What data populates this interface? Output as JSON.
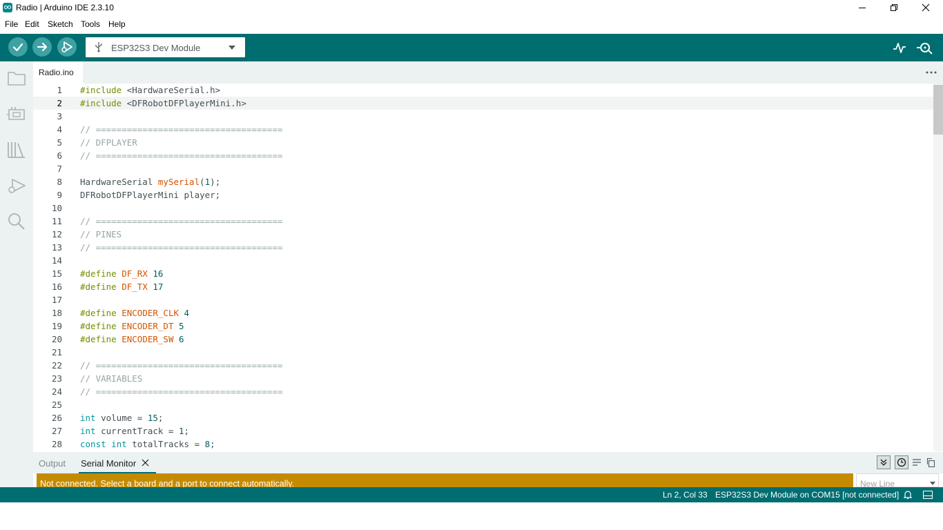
{
  "window": {
    "title": "Radio | Arduino IDE 2.3.10"
  },
  "menu": [
    "File",
    "Edit",
    "Sketch",
    "Tools",
    "Help"
  ],
  "toolbar": {
    "board": "ESP32S3 Dev Module"
  },
  "tabs": [
    {
      "label": "Radio.ino"
    }
  ],
  "editor": {
    "current_line": 2,
    "lines": [
      {
        "n": "1",
        "code": "#include <HardwareSerial.h>"
      },
      {
        "n": "2",
        "code": "#include <DFRobotDFPlayerMini.h>"
      },
      {
        "n": "3",
        "code": ""
      },
      {
        "n": "4",
        "code": "// ===================================="
      },
      {
        "n": "5",
        "code": "// DFPLAYER"
      },
      {
        "n": "6",
        "code": "// ===================================="
      },
      {
        "n": "7",
        "code": ""
      },
      {
        "n": "8",
        "code": "HardwareSerial mySerial(1);"
      },
      {
        "n": "9",
        "code": "DFRobotDFPlayerMini player;"
      },
      {
        "n": "10",
        "code": ""
      },
      {
        "n": "11",
        "code": "// ===================================="
      },
      {
        "n": "12",
        "code": "// PINES"
      },
      {
        "n": "13",
        "code": "// ===================================="
      },
      {
        "n": "14",
        "code": ""
      },
      {
        "n": "15",
        "code": "#define DF_RX 16"
      },
      {
        "n": "16",
        "code": "#define DF_TX 17"
      },
      {
        "n": "17",
        "code": ""
      },
      {
        "n": "18",
        "code": "#define ENCODER_CLK 4"
      },
      {
        "n": "19",
        "code": "#define ENCODER_DT 5"
      },
      {
        "n": "20",
        "code": "#define ENCODER_SW 6"
      },
      {
        "n": "21",
        "code": ""
      },
      {
        "n": "22",
        "code": "// ===================================="
      },
      {
        "n": "23",
        "code": "// VARIABLES"
      },
      {
        "n": "24",
        "code": "// ===================================="
      },
      {
        "n": "25",
        "code": ""
      },
      {
        "n": "26",
        "code": "int volume = 15;"
      },
      {
        "n": "27",
        "code": "int currentTrack = 1;"
      },
      {
        "n": "28",
        "code": "const int totalTracks = 8;"
      }
    ]
  },
  "panel": {
    "tabs": [
      "Output",
      "Serial Monitor"
    ],
    "notice": "Not connected. Select a board and a port to connect automatically.",
    "line_ending": "New Line"
  },
  "status": {
    "position": "Ln 2, Col 33",
    "board_port": "ESP32S3 Dev Module on COM15 [not connected]"
  },
  "colors": {
    "teal": "#006d70",
    "warning": "#c58b00"
  }
}
